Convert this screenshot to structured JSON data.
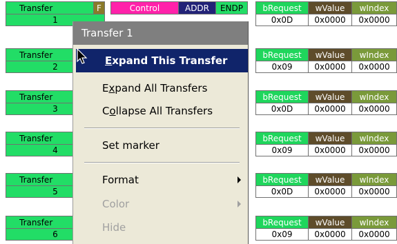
{
  "header": {
    "f_label": "F",
    "control_label": "Control",
    "addr_label": "ADDR",
    "endp_label": "ENDP",
    "brequest_label": "bRequest",
    "wvalue_label": "wValue",
    "windex_label": "wIndex"
  },
  "transfers": [
    {
      "name": "Transfer",
      "num": "1",
      "brequest": "0x0D",
      "wvalue": "0x0000",
      "windex": "0x0000"
    },
    {
      "name": "Transfer",
      "num": "2",
      "brequest": "0x09",
      "wvalue": "0x0000",
      "windex": "0x0000"
    },
    {
      "name": "Transfer",
      "num": "3",
      "brequest": "0x0D",
      "wvalue": "0x0000",
      "windex": "0x0000"
    },
    {
      "name": "Transfer",
      "num": "4",
      "brequest": "0x09",
      "wvalue": "0x0000",
      "windex": "0x0000"
    },
    {
      "name": "Transfer",
      "num": "5",
      "brequest": "0x0D",
      "wvalue": "0x0000",
      "windex": "0x0000"
    },
    {
      "name": "Transfer",
      "num": "6",
      "brequest": "0x09",
      "wvalue": "0x0000",
      "windex": "0x0000"
    }
  ],
  "context_menu": {
    "title": "Transfer 1",
    "items": [
      {
        "pre": "",
        "ul": "E",
        "post": "xpand This Transfer"
      },
      {
        "pre": "E",
        "ul": "x",
        "post": "pand All Transfers"
      },
      {
        "pre": "C",
        "ul": "o",
        "post": "llapse All Transfers"
      },
      {
        "pre": "",
        "ul": "",
        "post": "Set marker"
      },
      {
        "pre": "",
        "ul": "",
        "post": "Format"
      },
      {
        "pre": "",
        "ul": "",
        "post": "Color"
      },
      {
        "pre": "",
        "ul": "",
        "post": "Hide"
      }
    ]
  },
  "colors": {
    "transfer_green": "#22dd66",
    "control_pink": "#ff22aa",
    "addr_navy": "#222277",
    "brequest_green": "#1fd65c",
    "wvalue_brown": "#5e4c2a",
    "windex_olive": "#7a9a3a",
    "menu_highlight": "#10246a",
    "menu_title_bg": "#7f7f7f"
  }
}
